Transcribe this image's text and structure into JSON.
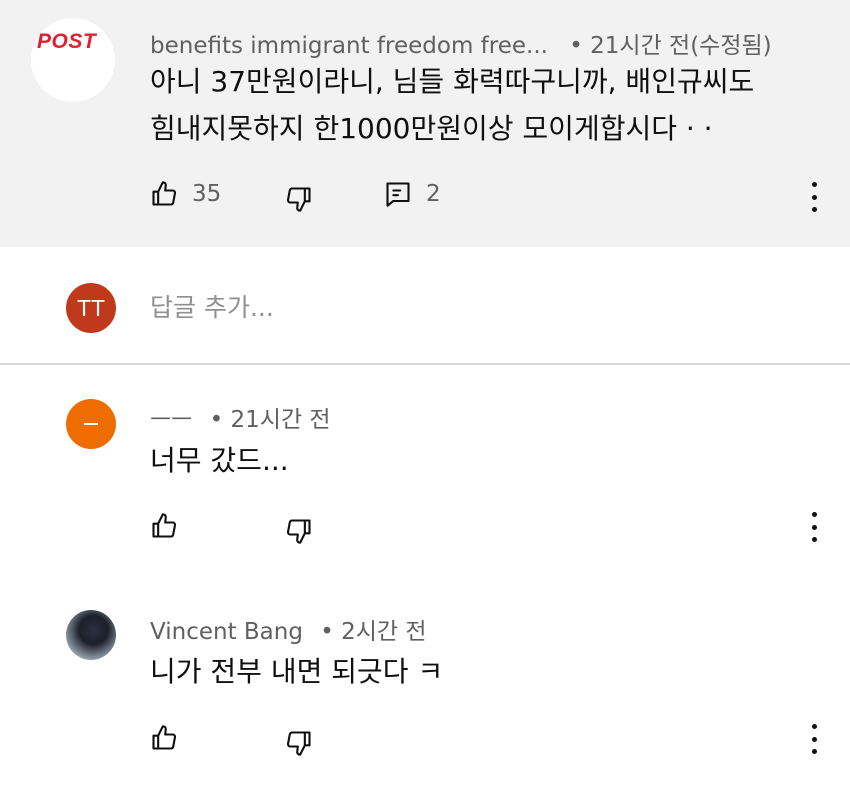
{
  "top_comment": {
    "avatar_text": "POST",
    "author": "benefits immigrant freedom free...",
    "time": "• 21시간 전(수정됨)",
    "text_line1": "아니 37만원이라니,  님들 화력따구니까, 배인규씨도",
    "text_line2": "힘내지못하지 한1000만원이상 모이게합시다 · ·",
    "likes": "35",
    "replies": "2"
  },
  "reply_box": {
    "avatar_initials": "TT",
    "placeholder": "답글 추가..."
  },
  "replies": [
    {
      "author": "ㅡㅡ",
      "time": "• 21시간 전",
      "text": "너무 갔드..."
    },
    {
      "author": "Vincent Bang",
      "time": "• 2시간 전",
      "text": "니가 전부 내면 되긋다 ㅋ"
    }
  ],
  "colors": {
    "highlight_bg": "#f2f2f2",
    "meta_text": "#606060",
    "avatar_tt": "#c0391c",
    "avatar_orange": "#ef6c00",
    "post_red": "#e0202f"
  }
}
